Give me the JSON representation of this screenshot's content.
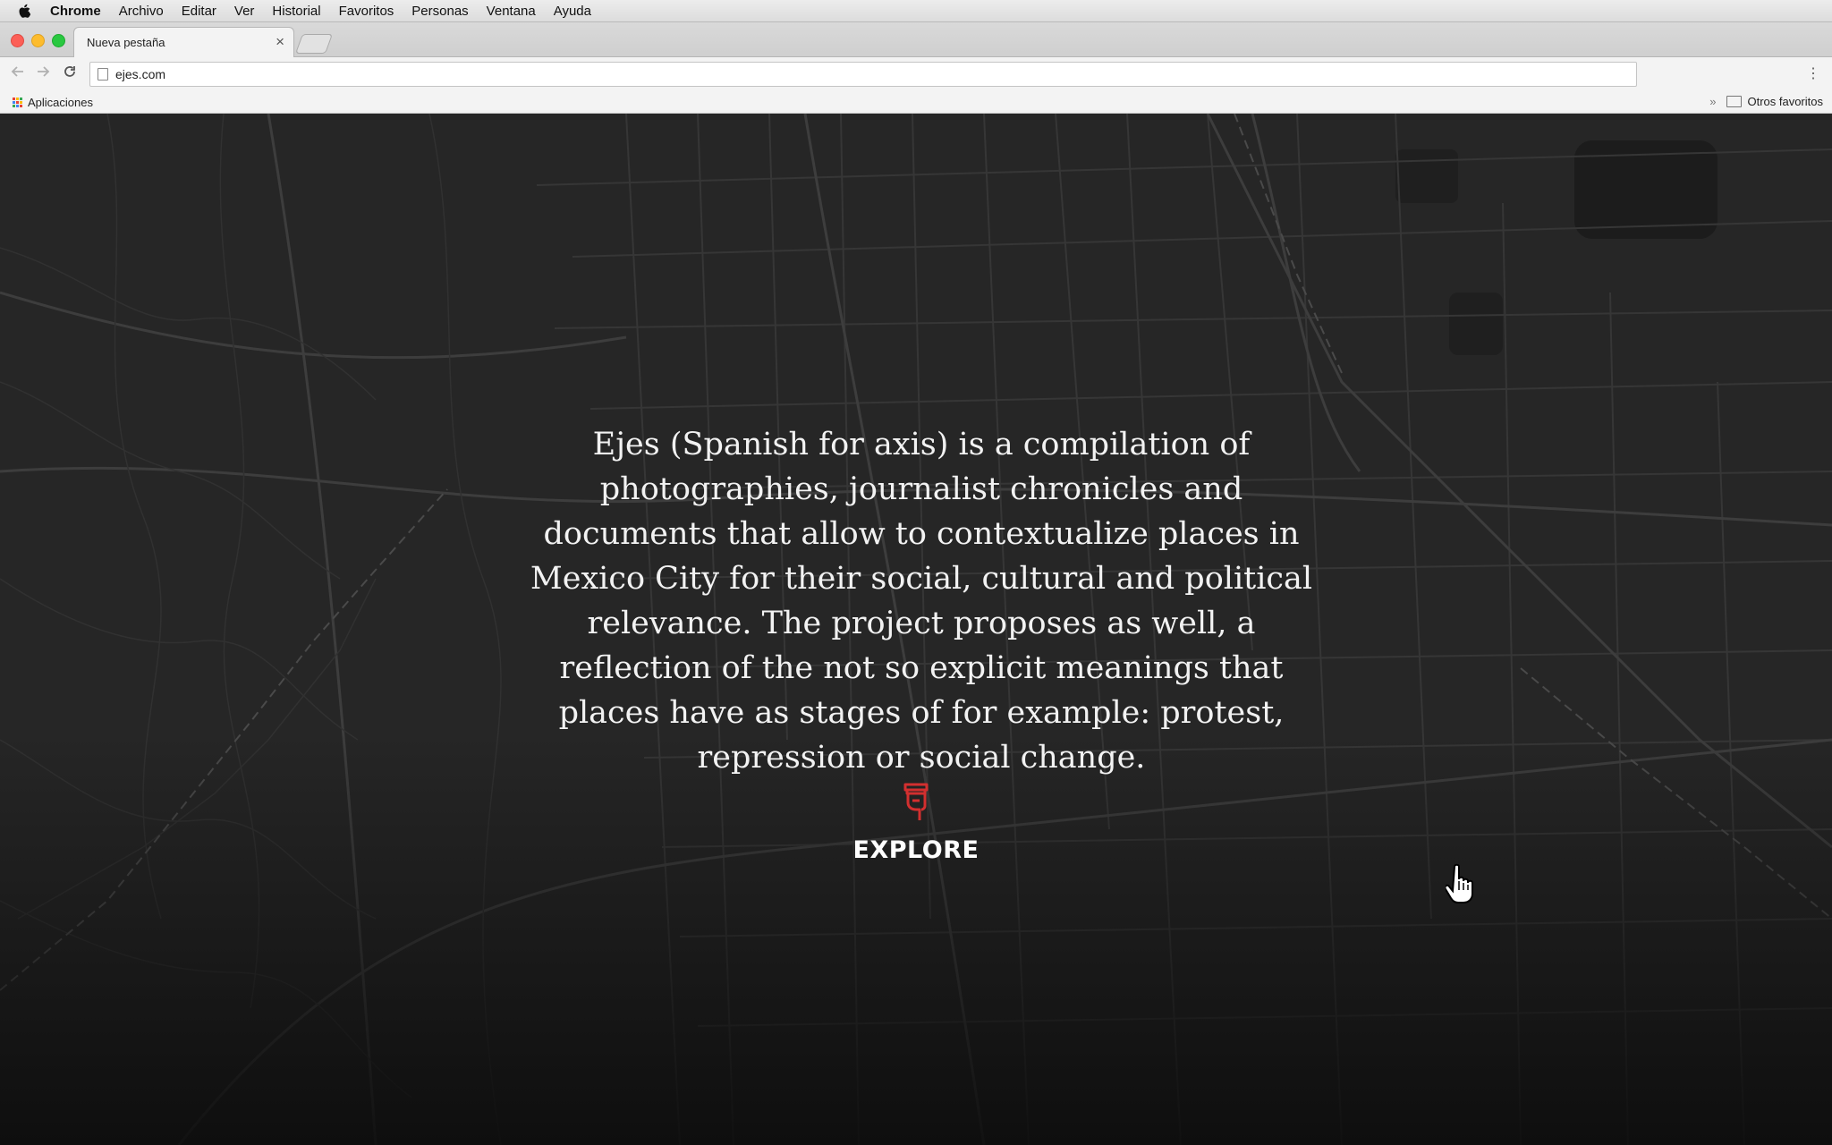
{
  "menubar": {
    "apple_icon": "apple-icon",
    "items": [
      "Chrome",
      "Archivo",
      "Editar",
      "Ver",
      "Historial",
      "Favoritos",
      "Personas",
      "Ventana",
      "Ayuda"
    ]
  },
  "tabs": [
    {
      "title": "Nueva pestaña",
      "close": "×"
    }
  ],
  "toolbar": {
    "url": "ejes.com",
    "menu_icon": "⋮"
  },
  "bookmarks": {
    "apps_label": "Aplicaciones",
    "overflow": "»",
    "other_label": "Otros favoritos"
  },
  "page": {
    "intro_text": "Ejes (Spanish for axis) is a compilation of photographies, journalist chronicles and documents that allow to contextualize places in Mexico City for their social, cultural and political relevance. The project proposes as well, a reflection of the not so explicit meanings that places have as stages of for example: protest, repression or social change.",
    "explore_label": "EXPLORE",
    "explore_icon": "pointing-hand-icon",
    "accent_color": "#d32f2f",
    "background_color": "#252525"
  }
}
